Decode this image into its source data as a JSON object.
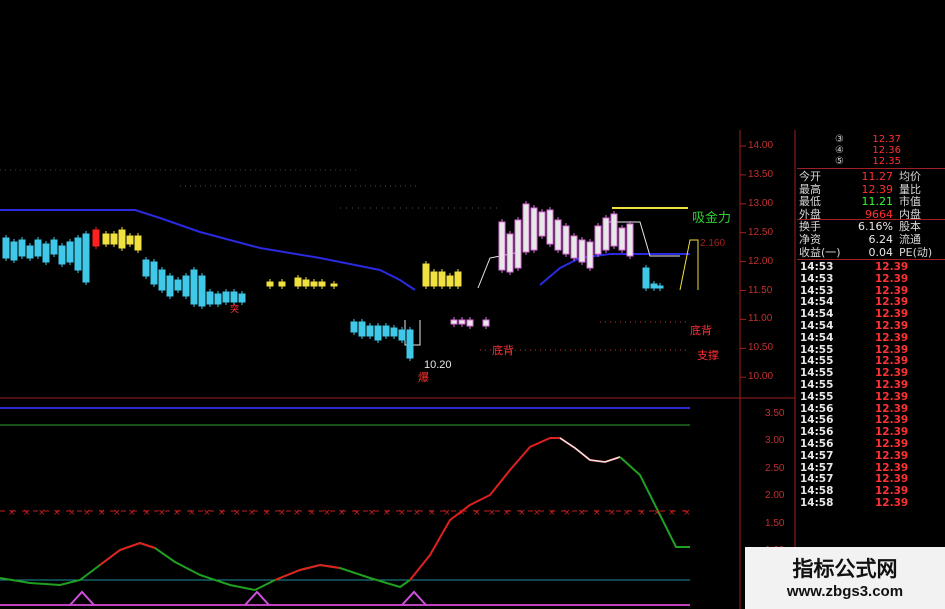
{
  "price_axis": [
    "14.00",
    "13.50",
    "13.00",
    "12.50",
    "12.00",
    "11.50",
    "11.00",
    "10.50",
    "10.00"
  ],
  "indicator_axis": [
    "3.50",
    "3.00",
    "2.50",
    "2.00",
    "1.50",
    "1.00"
  ],
  "annotations": {
    "low_price": "10.20",
    "label_tupo": "突",
    "label_bao": "爆",
    "label_dibei": "底背",
    "label_dibei_right": "底背",
    "label_zhicheng": "支撑",
    "label_xijinli": "吸金力",
    "label_right_value": "2.160"
  },
  "quote_top": [
    {
      "mark": "③",
      "value": "12.37"
    },
    {
      "mark": "④",
      "value": "12.36"
    },
    {
      "mark": "⑤",
      "value": "12.35"
    }
  ],
  "quote_rows": [
    {
      "k": "今开",
      "v": "11.27",
      "c": "#ff3030",
      "k2": "均价"
    },
    {
      "k": "最高",
      "v": "12.39",
      "c": "#ff3030",
      "k2": "量比"
    },
    {
      "k": "最低",
      "v": "11.21",
      "c": "#30ff30",
      "k2": "市值"
    },
    {
      "k": "外盘",
      "v": "9664",
      "c": "#ff3030",
      "k2": "内盘"
    },
    {
      "k": "换手",
      "v": "6.16%",
      "c": "#e8e8e8",
      "k2": "股本"
    },
    {
      "k": "净资",
      "v": "6.24",
      "c": "#e8e8e8",
      "k2": "流通"
    },
    {
      "k": "收益(一)",
      "v": "0.04",
      "c": "#e8e8e8",
      "k2": "PE(动)"
    }
  ],
  "ticks": [
    {
      "t": "14:53",
      "p": "12.39"
    },
    {
      "t": "14:53",
      "p": "12.39"
    },
    {
      "t": "14:53",
      "p": "12.39"
    },
    {
      "t": "14:54",
      "p": "12.39"
    },
    {
      "t": "14:54",
      "p": "12.39"
    },
    {
      "t": "14:54",
      "p": "12.39"
    },
    {
      "t": "14:54",
      "p": "12.39"
    },
    {
      "t": "14:55",
      "p": "12.39"
    },
    {
      "t": "14:55",
      "p": "12.39"
    },
    {
      "t": "14:55",
      "p": "12.39"
    },
    {
      "t": "14:55",
      "p": "12.39"
    },
    {
      "t": "14:55",
      "p": "12.39"
    },
    {
      "t": "14:56",
      "p": "12.39"
    },
    {
      "t": "14:56",
      "p": "12.39"
    },
    {
      "t": "14:56",
      "p": "12.39"
    },
    {
      "t": "14:56",
      "p": "12.39"
    },
    {
      "t": "14:57",
      "p": "12.39"
    },
    {
      "t": "14:57",
      "p": "12.39"
    },
    {
      "t": "14:57",
      "p": "12.39"
    },
    {
      "t": "14:58",
      "p": "12.39"
    },
    {
      "t": "14:58",
      "p": "12.39"
    }
  ],
  "watermark": {
    "title": "指标公式网",
    "url": "www.zbgs3.com"
  },
  "colors": {
    "up": "#e070e0",
    "down": "#40c8e8",
    "neutral": "#f0e040",
    "band": "#2030e0",
    "macd_up": "#e02020",
    "macd_down": "#20a020"
  }
}
